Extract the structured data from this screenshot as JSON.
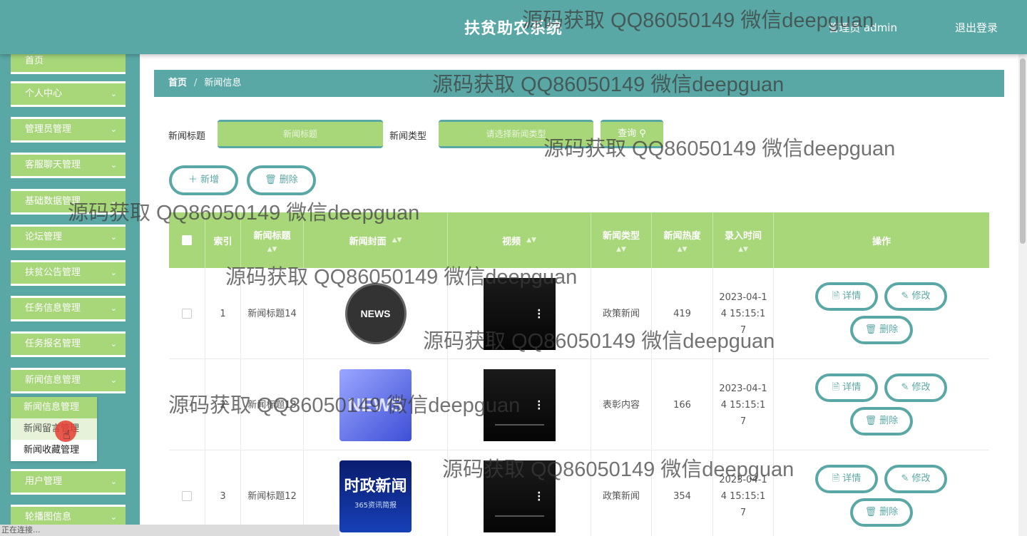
{
  "header": {
    "title": "扶贫助农系统",
    "user": "管理员 admin",
    "logout": "退出登录"
  },
  "sidebar": {
    "items": [
      {
        "label": "首页",
        "chev": ""
      },
      {
        "label": "个人中心",
        "chev": "⌄"
      },
      {
        "label": "管理员管理",
        "chev": "⌄"
      },
      {
        "label": "客服聊天管理",
        "chev": "⌄"
      },
      {
        "label": "基础数据管理",
        "chev": "⌄"
      },
      {
        "label": "论坛管理",
        "chev": "⌄"
      },
      {
        "label": "扶贫公告管理",
        "chev": "⌄"
      },
      {
        "label": "任务信息管理",
        "chev": "⌄"
      },
      {
        "label": "任务报名管理",
        "chev": "⌄"
      },
      {
        "label": "新闻信息管理",
        "chev": "⌄"
      },
      {
        "label": "用户管理",
        "chev": "⌄"
      },
      {
        "label": "轮播图信息",
        "chev": "⌄"
      }
    ],
    "submenu": [
      "新闻信息管理",
      "新闻留言管理",
      "新闻收藏管理"
    ]
  },
  "status_text": "正在连接...",
  "breadcrumb": {
    "home": "首页",
    "separator": "/",
    "current": "新闻信息"
  },
  "search": {
    "title_label": "新闻标题",
    "title_placeholder": "新闻标题",
    "type_label": "新闻类型",
    "type_placeholder": "请选择新闻类型",
    "button": "查询 ⚲"
  },
  "actions": {
    "add": "＋ 新增",
    "delete": "🗑 删除"
  },
  "table": {
    "headers": [
      "索引",
      "新闻标题",
      "新闻封面",
      "视频",
      "新闻类型",
      "新闻热度",
      "录入时间",
      "操作"
    ],
    "sort_icon": "▲▼",
    "rows": [
      {
        "index": "1",
        "title": "新闻标题14",
        "cover": "NEWS",
        "type": "政策新闻",
        "heat": "419",
        "time": "2023-04-14 15:15:17"
      },
      {
        "index": "2",
        "title": "新闻标题13",
        "cover": "NEWS",
        "type": "表彰内容",
        "heat": "166",
        "time": "2023-04-14 15:15:17"
      },
      {
        "index": "3",
        "title": "新闻标题12",
        "cover": "时政新闻",
        "cover_sub": "365资讯简报",
        "type": "政策新闻",
        "heat": "354",
        "time": "2023-04-14 15:15:17"
      }
    ],
    "row_actions": {
      "detail": "🗎 详情",
      "edit": "✎ 修改",
      "delete": "🗑 删除"
    }
  },
  "watermark": "源码获取 QQ86050149 微信deepguan",
  "colors": {
    "teal": "#5aa8a6",
    "green": "#a8d77a",
    "white": "#ffffff"
  }
}
